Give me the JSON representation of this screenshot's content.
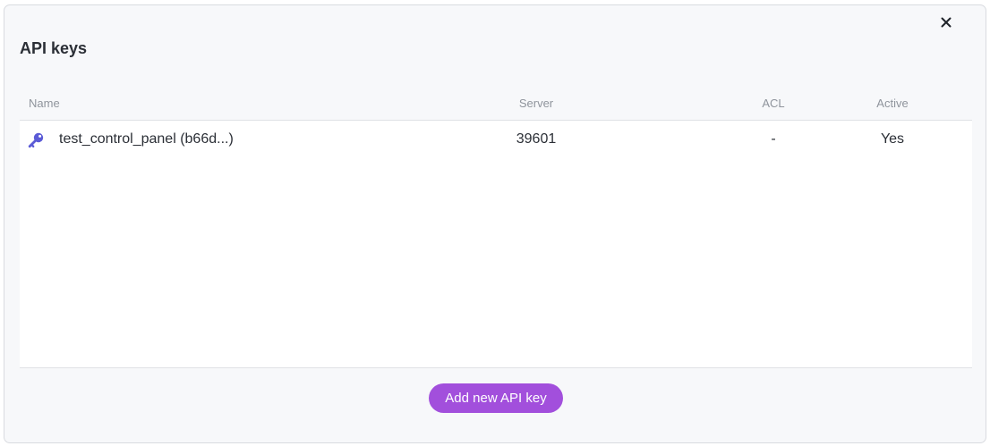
{
  "dialog": {
    "title": "API keys",
    "close_icon": "close-icon"
  },
  "table": {
    "columns": {
      "name": "Name",
      "server": "Server",
      "acl": "ACL",
      "active": "Active"
    },
    "rows": [
      {
        "icon": "key-icon",
        "name": "test_control_panel (b66d...)",
        "server": "39601",
        "acl": "-",
        "active": "Yes"
      }
    ]
  },
  "actions": {
    "add_label": "Add new API key"
  },
  "colors": {
    "accent": "#a24fdc",
    "key_icon": "#5b5bd6"
  }
}
